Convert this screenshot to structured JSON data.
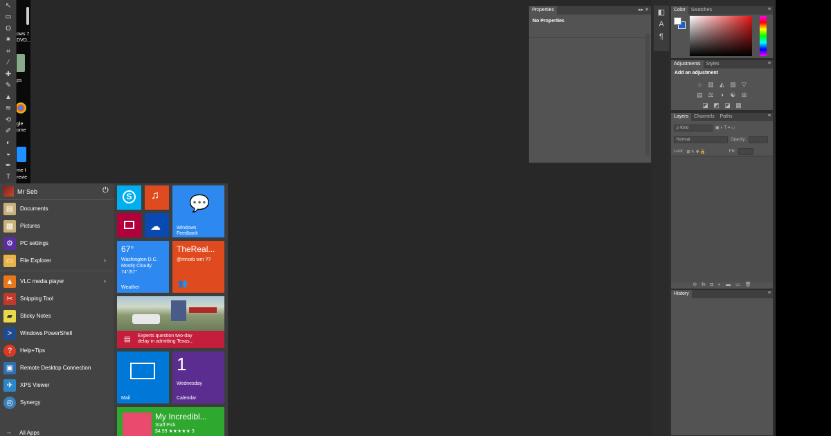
{
  "desktop": {
    "items": [
      "ows 7",
      "DVD...",
      "ps",
      "gle",
      "ome",
      "me t",
      "revie"
    ]
  },
  "tools": {
    "glyphs": [
      "↖",
      "▭",
      "ʘ",
      "✷",
      "⌗",
      "⁄",
      "✚",
      "✎",
      "▲",
      "≋",
      "⟲",
      "✐",
      "◐",
      "◒",
      "●",
      "ˢ",
      "✒",
      "T"
    ]
  },
  "properties": {
    "tab": "Properties",
    "content": "No Properties"
  },
  "dock": {
    "glyphs": [
      "◧",
      "A",
      "¶"
    ]
  },
  "color_panel": {
    "tab_active": "Color",
    "tab_inactive": "Swatches"
  },
  "adjustments_panel": {
    "tab_active": "Adjustments",
    "tab_inactive": "Styles",
    "title": "Add an adjustment",
    "row1": [
      "☼",
      "▥",
      "◭",
      "▨",
      "▽"
    ],
    "row2": [
      "▤",
      "⚖",
      "◑",
      "☯",
      "⊞"
    ],
    "row3": [
      "◪",
      "◩",
      "◪",
      "▦"
    ]
  },
  "layers_panel": {
    "tab_active": "Layers",
    "tab_2": "Channels",
    "tab_3": "Paths",
    "kind": "ρ Kind",
    "blend_mode": "Normal",
    "opacity_label": "Opacity:",
    "lock_label": "Lock:",
    "fill_label": "Fill:",
    "footer_icons": [
      "⊖",
      "fx",
      "◘",
      "◐",
      "▬",
      "▭",
      "🗑"
    ]
  },
  "history_panel": {
    "tab": "History"
  },
  "start_menu": {
    "user_name": "Mr Seb",
    "items": [
      {
        "label": "Documents",
        "color": "#c8b07a",
        "glyph": "▤"
      },
      {
        "label": "Pictures",
        "color": "#c8b07a",
        "glyph": "▦"
      },
      {
        "label": "PC settings",
        "color": "#5a2ea0",
        "glyph": "⚙"
      },
      {
        "label": "File Explorer",
        "color": "#e8b34a",
        "glyph": "▭"
      },
      {
        "label": "VLC media player",
        "color": "#e8761a",
        "glyph": "▲"
      },
      {
        "label": "Snipping Tool",
        "color": "#c0392b",
        "glyph": "✂"
      },
      {
        "label": "Sticky Notes",
        "color": "#e8d94a",
        "glyph": "▰"
      },
      {
        "label": "Windows PowerShell",
        "color": "#1f4b8e",
        "glyph": ">"
      },
      {
        "label": "Help+Tips",
        "color": "#d63b2a",
        "glyph": "?"
      },
      {
        "label": "Remote Desktop Connection",
        "color": "#2f6fb3",
        "glyph": "▣"
      },
      {
        "label": "XPS Viewer",
        "color": "#2b87c9",
        "glyph": "✈"
      },
      {
        "label": "Synergy",
        "color": "#3a7fb8",
        "glyph": "◎"
      }
    ],
    "all_apps": "All Apps"
  },
  "tiles": {
    "windows_feedback": "Windows Feedback",
    "weather_temp": "67°",
    "weather_city": "Washington D.C.",
    "weather_cond": "Mostly Cloudy",
    "weather_range": "74°/57°",
    "weather_label": "Weather",
    "people_name": "TheReal...",
    "people_handle": "@mrseb wm ??",
    "news_headline": "Experts question two-day delay in admitting Texas...",
    "mail_label": "Mail",
    "calendar_day": "1",
    "calendar_weekday": "Wednesday",
    "calendar_label": "Calendar",
    "store_title": "My Incredibl...",
    "store_pick": "Staff Pick",
    "store_price": "$4.99 ★★★★★ 3"
  }
}
